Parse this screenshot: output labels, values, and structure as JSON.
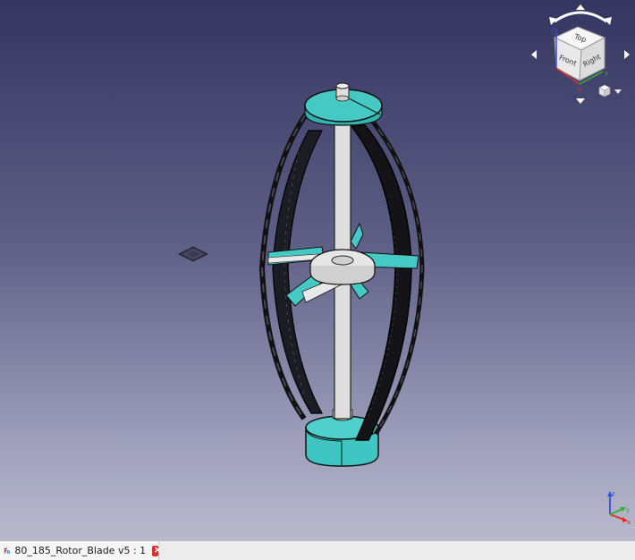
{
  "view": {
    "background_top": "#343661",
    "background_bottom": "#b9b9cd",
    "model_accent": "#41c6c3",
    "shaft_color": "#dcdcdc"
  },
  "navcube": {
    "faces": {
      "top": "Top",
      "front": "Front",
      "right": "Right"
    },
    "axis_labels": {
      "x": "x",
      "y": "y",
      "z": "z"
    }
  },
  "axis_triad": {
    "labels": {
      "x": "x",
      "y": "y",
      "z": "z"
    },
    "colors": {
      "x": "#e0302a",
      "y": "#38b030",
      "z": "#3050e0"
    }
  },
  "tabs": [
    {
      "label": "80_185_Rotor_Blade v5 : 1",
      "icon": "freecad-document-icon",
      "close_icon": "close-icon"
    }
  ]
}
